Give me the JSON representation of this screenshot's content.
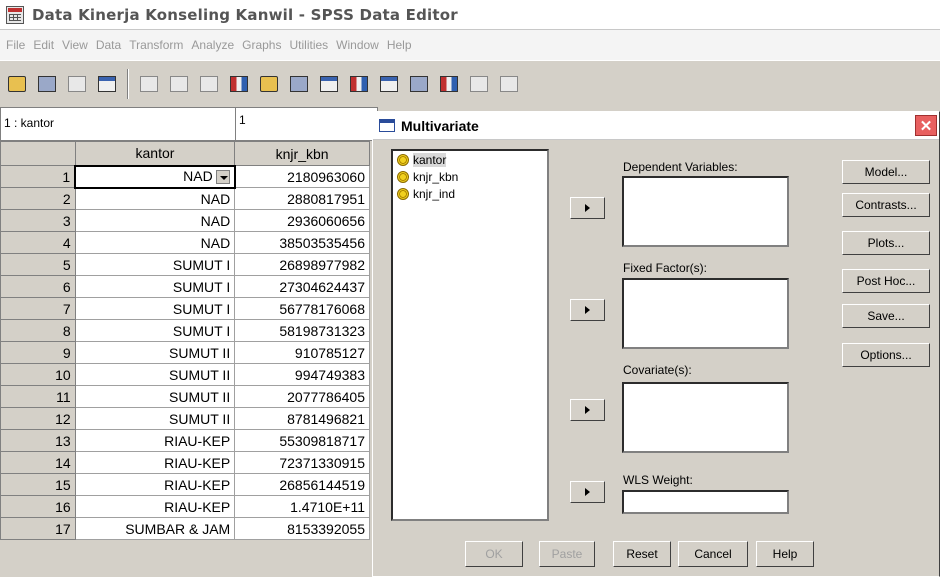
{
  "window": {
    "title": "Data Kinerja Konseling Kanwil - SPSS Data Editor"
  },
  "menu": [
    "File",
    "Edit",
    "View",
    "Data",
    "Transform",
    "Analyze",
    "Graphs",
    "Utilities",
    "Window",
    "Help"
  ],
  "cell": {
    "ref": "1 : kantor",
    "value": "1"
  },
  "grid": {
    "columns": [
      "kantor",
      "knjr_kbn"
    ],
    "rows": [
      {
        "n": "1",
        "kantor": "NAD",
        "knjr_kbn": "2180963060"
      },
      {
        "n": "2",
        "kantor": "NAD",
        "knjr_kbn": "2880817951"
      },
      {
        "n": "3",
        "kantor": "NAD",
        "knjr_kbn": "2936060656"
      },
      {
        "n": "4",
        "kantor": "NAD",
        "knjr_kbn": "38503535456"
      },
      {
        "n": "5",
        "kantor": "SUMUT I",
        "knjr_kbn": "26898977982"
      },
      {
        "n": "6",
        "kantor": "SUMUT I",
        "knjr_kbn": "27304624437"
      },
      {
        "n": "7",
        "kantor": "SUMUT I",
        "knjr_kbn": "56778176068"
      },
      {
        "n": "8",
        "kantor": "SUMUT I",
        "knjr_kbn": "58198731323"
      },
      {
        "n": "9",
        "kantor": "SUMUT II",
        "knjr_kbn": "910785127"
      },
      {
        "n": "10",
        "kantor": "SUMUT II",
        "knjr_kbn": "994749383"
      },
      {
        "n": "11",
        "kantor": "SUMUT II",
        "knjr_kbn": "2077786405"
      },
      {
        "n": "12",
        "kantor": "SUMUT II",
        "knjr_kbn": "8781496821"
      },
      {
        "n": "13",
        "kantor": "RIAU-KEP",
        "knjr_kbn": "55309818717"
      },
      {
        "n": "14",
        "kantor": "RIAU-KEP",
        "knjr_kbn": "72371330915"
      },
      {
        "n": "15",
        "kantor": "RIAU-KEP",
        "knjr_kbn": "26856144519"
      },
      {
        "n": "16",
        "kantor": "RIAU-KEP",
        "knjr_kbn": "1.4710E+11"
      },
      {
        "n": "17",
        "kantor": "SUMBAR & JAM",
        "knjr_kbn": "8153392055"
      }
    ]
  },
  "dialog": {
    "title": "Multivariate",
    "close": "✕",
    "variables": [
      "kantor",
      "knjr_kbn",
      "knjr_ind"
    ],
    "labels": {
      "dependent": "Dependent Variables:",
      "fixed": "Fixed Factor(s):",
      "covariate": "Covariate(s):",
      "wls": "WLS Weight:"
    },
    "side_buttons": [
      "Model...",
      "Contrasts...",
      "Plots...",
      "Post Hoc...",
      "Save...",
      "Options..."
    ],
    "bottom_buttons": [
      "OK",
      "Paste",
      "Reset",
      "Cancel",
      "Help"
    ]
  }
}
